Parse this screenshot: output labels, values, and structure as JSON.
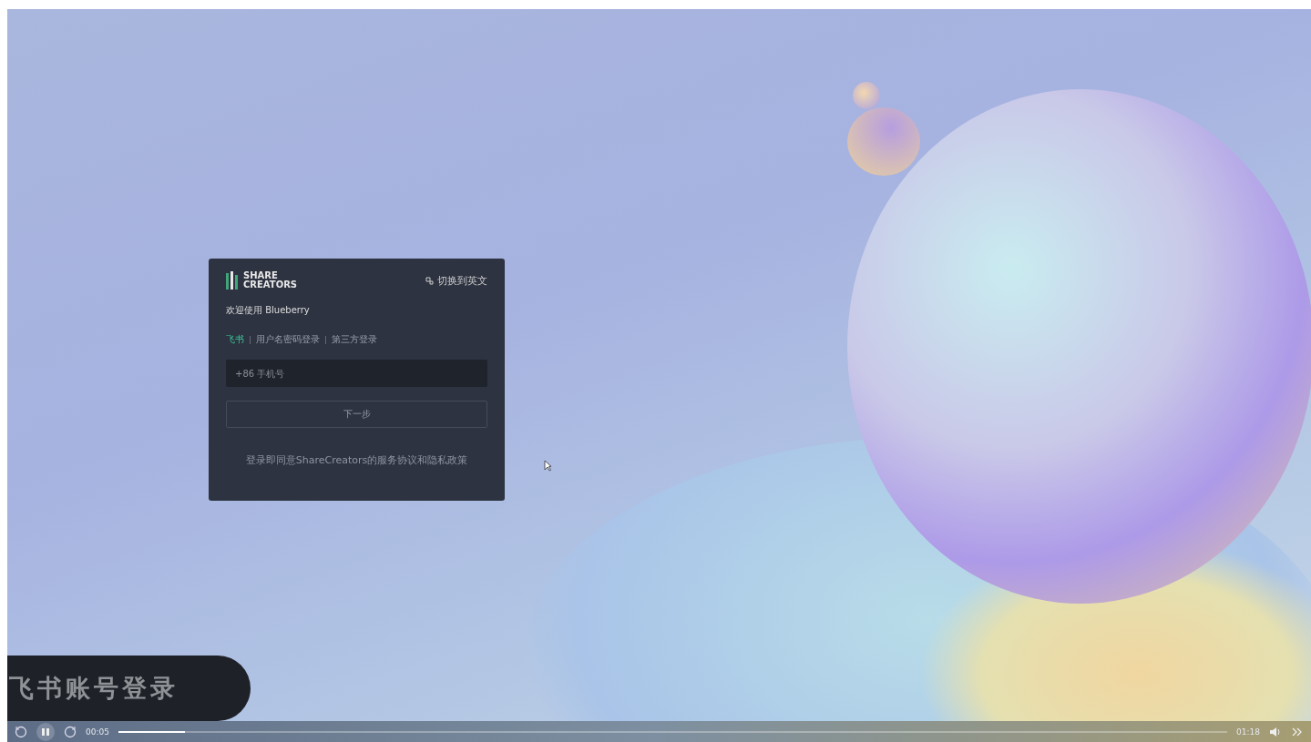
{
  "login_card": {
    "logo": "SHARE CREATORS",
    "language_switch": "切换到英文",
    "welcome": "欢迎使用 Blueberry",
    "tabs": [
      {
        "label": "飞书",
        "selected": true
      },
      {
        "label": "用户名密码登录",
        "selected": false
      },
      {
        "label": "第三方登录",
        "selected": false
      }
    ],
    "phone_field": {
      "placeholder": "+86 手机号"
    },
    "next_button": "下一步",
    "terms": "登录即同意ShareCreators的服务协议和隐私政策"
  },
  "caption": "飞书账号登录",
  "player": {
    "current_time": "00:05",
    "level": 0.06,
    "duration": "01:18"
  }
}
